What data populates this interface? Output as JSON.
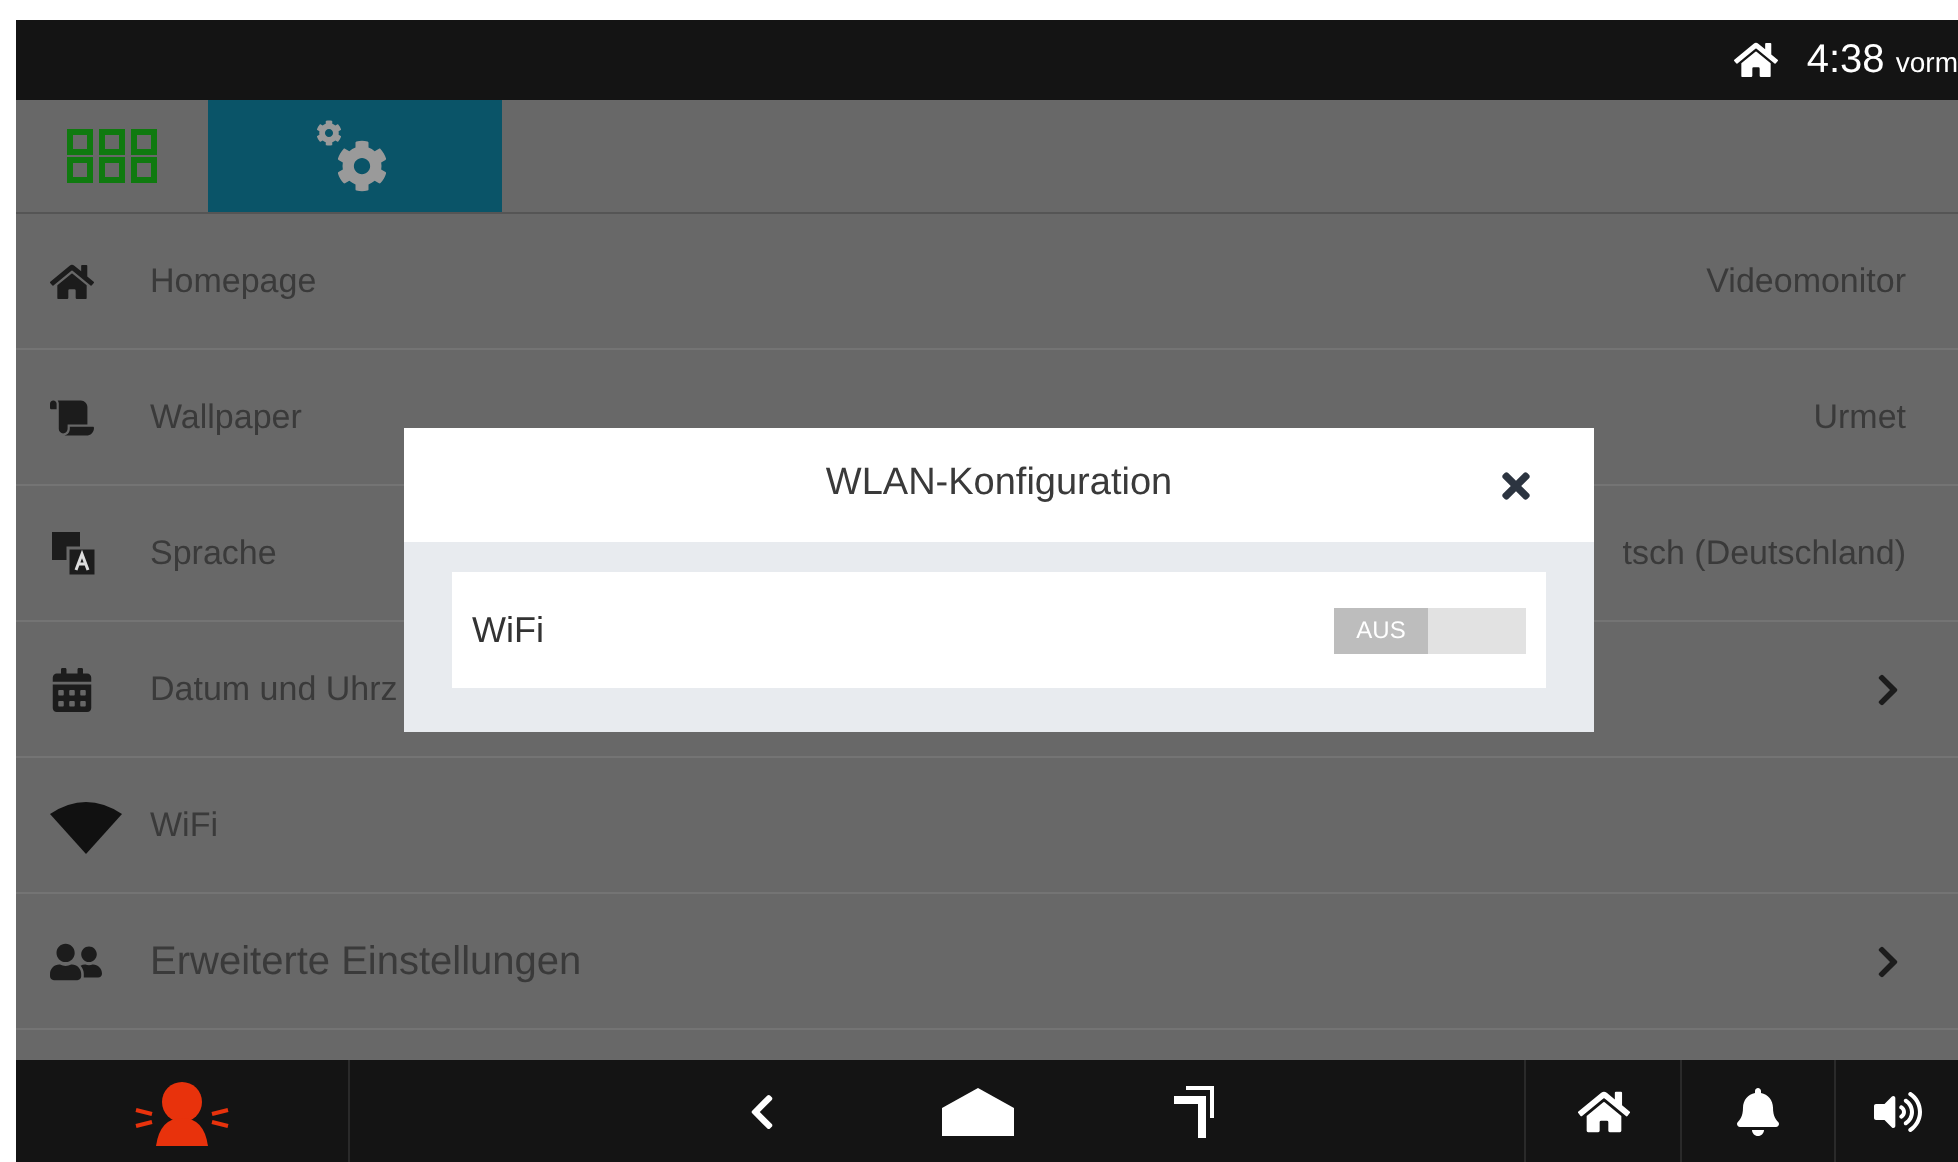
{
  "status_bar": {
    "time": "4:38",
    "period": "vorm"
  },
  "tabs": [
    {
      "kind": "grid",
      "selected": false
    },
    {
      "kind": "settings",
      "selected": true
    }
  ],
  "settings": [
    {
      "label": "Homepage",
      "value": "Videomonitor",
      "kind": "value"
    },
    {
      "label": "Wallpaper",
      "value": "Urmet",
      "kind": "value"
    },
    {
      "label": "Sprache",
      "value": "tsch (Deutschland)",
      "kind": "value"
    },
    {
      "label": "Datum und Uhrz",
      "kind": "chevron"
    },
    {
      "label": "WiFi",
      "kind": "plain"
    },
    {
      "label": "Erweiterte Einstellungen",
      "kind": "chevron"
    }
  ],
  "dialog": {
    "title": "WLAN-Konfiguration",
    "rows": [
      {
        "label": "WiFi",
        "switch_text": "AUS",
        "on": false
      }
    ]
  }
}
